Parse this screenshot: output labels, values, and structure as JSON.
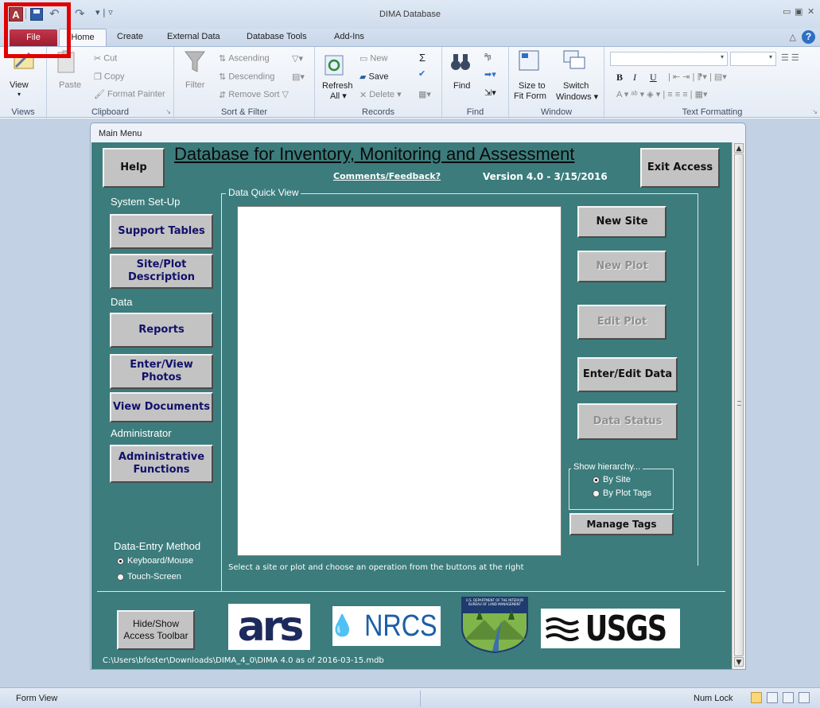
{
  "window": {
    "title": "DIMA Database",
    "app_icon_letter": "A",
    "controls": [
      "▭",
      "▣",
      "✕"
    ]
  },
  "qat": {
    "undo": "↶",
    "redo": "↷",
    "customize": "▾ | ▿"
  },
  "tabs": [
    {
      "label": "File",
      "active": false
    },
    {
      "label": "Home",
      "active": true
    },
    {
      "label": "Create"
    },
    {
      "label": "External Data"
    },
    {
      "label": "Database Tools"
    },
    {
      "label": "Add-Ins"
    }
  ],
  "ribbon": {
    "views": {
      "label": "Views",
      "view": "View"
    },
    "clipboard": {
      "label": "Clipboard",
      "paste": "Paste",
      "cut": "Cut",
      "copy": "Copy",
      "format_painter": "Format Painter"
    },
    "sort_filter": {
      "label": "Sort & Filter",
      "filter": "Filter",
      "ascending": "Ascending",
      "descending": "Descending",
      "remove_sort": "Remove Sort"
    },
    "records": {
      "label": "Records",
      "refresh": "Refresh",
      "refresh_all": "All ▾",
      "new": "New",
      "save": "Save",
      "delete": "Delete ▾",
      "totals": "Σ"
    },
    "find": {
      "label": "Find",
      "find": "Find"
    },
    "window": {
      "label": "Window",
      "size_to_fit_1": "Size to",
      "size_to_fit_2": "Fit Form",
      "switch_1": "Switch",
      "switch_2": "Windows ▾"
    },
    "text_formatting": {
      "label": "Text Formatting",
      "bold": "B",
      "italic": "I",
      "underline": "U"
    }
  },
  "form": {
    "caption": "Main Menu",
    "title": "Database for Inventory, Monitoring and Assessment",
    "feedback_link": "Comments/Feedback?",
    "version": "Version 4.0 - 3/15/2016",
    "help_button": "Help",
    "exit_button": "Exit Access",
    "section_system_setup": "System Set-Up",
    "support_tables": "Support Tables",
    "site_plot_1": "Site/Plot",
    "site_plot_2": "Description",
    "section_data": "Data",
    "reports": "Reports",
    "photos_1": "Enter/View",
    "photos_2": "Photos",
    "view_documents": "View Documents",
    "section_admin": "Administrator",
    "admin_1": "Administrative",
    "admin_2": "Functions",
    "entry_method_label": "Data-Entry Method",
    "entry_keyboard": "Keyboard/Mouse",
    "entry_touch": "Touch-Screen",
    "quick_view_label": "Data Quick View",
    "instruction": "Select a site or plot and choose an operation from the buttons at the right",
    "new_site": "New Site",
    "new_plot": "New Plot",
    "edit_plot": "Edit Plot",
    "enter_edit_data": "Enter/Edit Data",
    "data_status": "Data Status",
    "hierarchy_label": "Show hierarchy...",
    "by_site": "By Site",
    "by_plot_tags": "By Plot Tags",
    "manage_tags": "Manage Tags",
    "hide_show_1": "Hide/Show",
    "hide_show_2": "Access Toolbar",
    "logo_ars": "ars",
    "logo_nrcs": "NRCS",
    "logo_blm_text": "U.S. DEPARTMENT OF THE INTERIOR BUREAU OF LAND MANAGEMENT",
    "logo_usgs": "USGS",
    "file_path": "C:\\Users\\bfoster\\Downloads\\DIMA_4_0\\DIMA 4.0 as of 2016-03-15.mdb"
  },
  "status": {
    "left": "Form View",
    "num_lock": "Num Lock"
  },
  "colors": {
    "form_bg": "#3c7c7c",
    "file_tab": "#a8203a",
    "highlight": "#e00000"
  }
}
